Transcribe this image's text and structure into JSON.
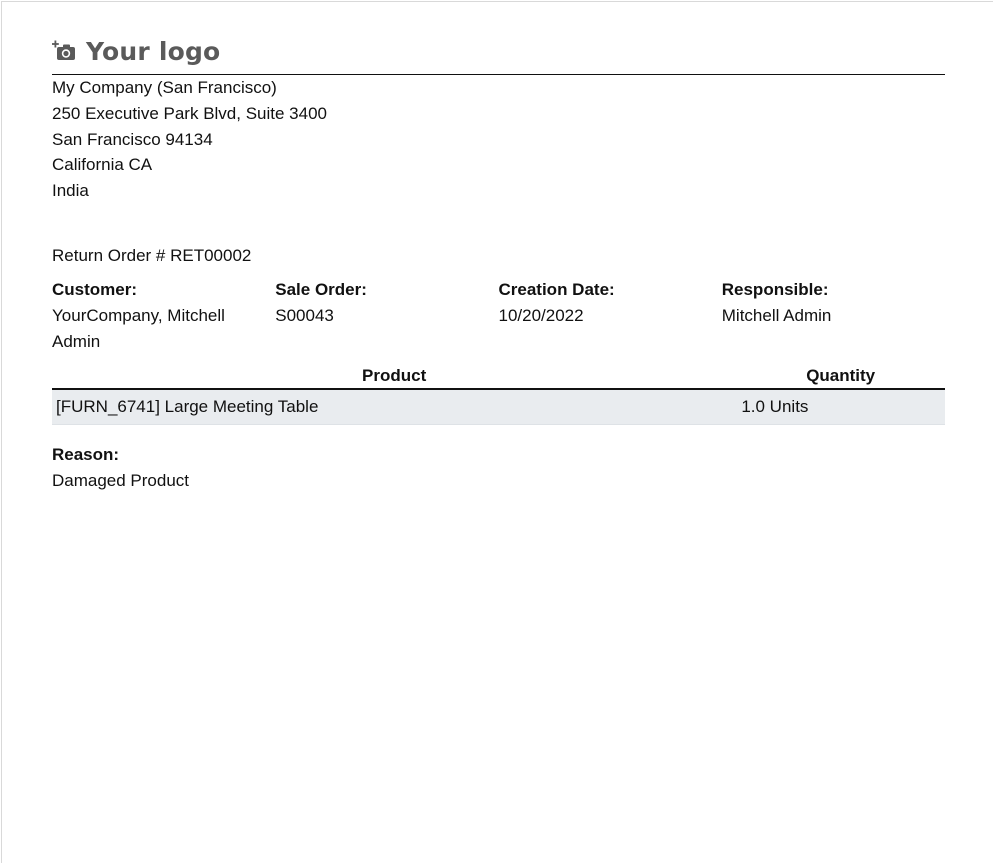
{
  "logo": {
    "text": "Your logo",
    "icon": "camera-add-icon"
  },
  "company": {
    "lines": [
      "My Company (San Francisco)",
      "250 Executive Park Blvd, Suite 3400",
      "San Francisco 94134",
      "California CA",
      "India"
    ]
  },
  "document": {
    "title": "Return Order # RET00002"
  },
  "info": {
    "customer_label": "Customer:",
    "customer_value": "YourCompany, Mitchell Admin",
    "sale_order_label": "Sale Order:",
    "sale_order_value": "S00043",
    "creation_date_label": "Creation Date:",
    "creation_date_value": "10/20/2022",
    "responsible_label": "Responsible:",
    "responsible_value": "Mitchell Admin"
  },
  "table": {
    "headers": {
      "product": "Product",
      "quantity": "Quantity"
    },
    "rows": [
      {
        "product": "[FURN_6741] Large Meeting Table",
        "quantity": "1.0 Units"
      }
    ]
  },
  "reason": {
    "label": "Reason:",
    "value": "Damaged Product"
  },
  "colors": {
    "logo_gray": "#5a5a5a",
    "row_background": "#e9ecef",
    "text": "#111111"
  }
}
